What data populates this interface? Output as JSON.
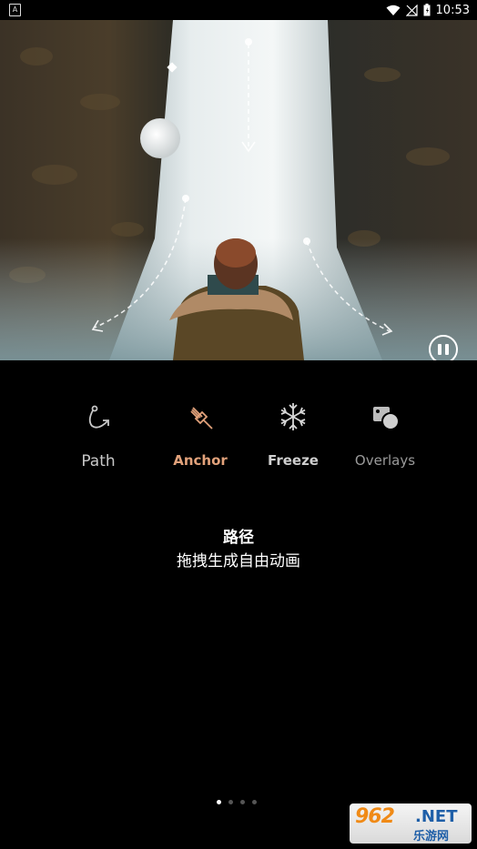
{
  "status_bar": {
    "app_indicator": "A",
    "time": "10:53"
  },
  "tabs": [
    {
      "id": "path",
      "label": "Path",
      "icon": "path-icon"
    },
    {
      "id": "anchor",
      "label": "Anchor",
      "icon": "anchor-pin-icon",
      "selected": true
    },
    {
      "id": "freeze",
      "label": "Freeze",
      "icon": "snowflake-icon"
    },
    {
      "id": "overlays",
      "label": "Overlays",
      "icon": "overlays-icon"
    }
  ],
  "caption": {
    "title": "路径",
    "subtitle": "拖拽生成自由动画"
  },
  "pager": {
    "pages": 4,
    "current": 1
  },
  "watermark": {
    "logo": "962",
    "net": ".NET",
    "sub": "乐游网"
  },
  "colors": {
    "selected_tab": "#e2a27b",
    "background": "#000000"
  }
}
